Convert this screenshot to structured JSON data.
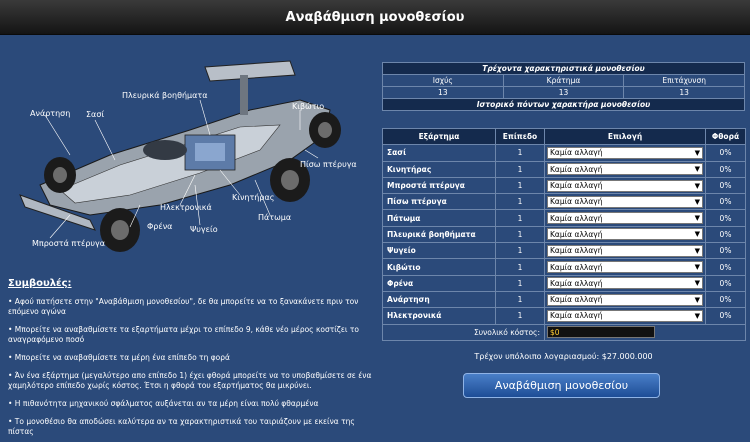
{
  "title": "Αναβάθμιση μονοθεσίου",
  "car_labels": [
    {
      "name": "label-suspension",
      "text": "Ανάρτηση"
    },
    {
      "name": "label-chassis",
      "text": "Σασί"
    },
    {
      "name": "label-sidepods",
      "text": "Πλευρικά βοηθήματα"
    },
    {
      "name": "label-gearbox",
      "text": "Κιβώτιο"
    },
    {
      "name": "label-rear-wing",
      "text": "Πίσω πτέρυγα"
    },
    {
      "name": "label-engine",
      "text": "Κινητήρας"
    },
    {
      "name": "label-electronics",
      "text": "Ηλεκτρονικά"
    },
    {
      "name": "label-floor",
      "text": "Πάτωμα"
    },
    {
      "name": "label-brakes",
      "text": "Φρένα"
    },
    {
      "name": "label-cooling",
      "text": "Ψυγείο"
    },
    {
      "name": "label-front-wing",
      "text": "Μπροστά πτέρυγα"
    }
  ],
  "tips": {
    "title": "Συμβουλές:",
    "items": [
      "• Αφού πατήσετε στην \"Αναβάθμιση μονοθεσίου\", δε θα μπορείτε να το ξανακάνετε πριν τον επόμενο αγώνα",
      "• Μπορείτε να αναβαθμίσετε τα εξαρτήματα μέχρι το επίπεδο 9, κάθε νέο μέρος κοστίζει το αναγραφόμενο ποσό",
      "• Μπορείτε να αναβαθμίσετε τα μέρη ένα επίπεδο τη φορά",
      "• Άν ένα εξάρτημα (μεγαλύτερο απο επίπεδο 1) έχει φθορά μπορείτε να το υποβαθμίσετε σε ένα χαμηλότερο επίπεδο χωρίς κόστος. Έτσι η φθορά του εξαρτήματος θα μικρύνει.",
      "• Η πιθανότητα μηχανικού σφάλματος αυξάνεται αν τα μέρη είναι πολύ φθαρμένα",
      "• Το μονοθέσιο θα αποδώσει καλύτερα αν τα χαρακτηριστικά του ταιριάζουν με εκείνα της πίστας"
    ]
  },
  "current_stats": {
    "header": "Τρέχοντα χαρακτηριστικά μονοθεσίου",
    "columns": [
      "Ισχύς",
      "Κράτημα",
      "Επιτάχυνση"
    ],
    "values": [
      "13",
      "13",
      "13"
    ],
    "history_header": "Ιστορικό πόντων χαρακτήρα μονοθεσίου"
  },
  "parts": {
    "columns": [
      "Εξάρτημα",
      "Επίπεδο",
      "Επιλογή",
      "Φθορά"
    ],
    "rows": [
      {
        "name": "Σασί",
        "level": "1",
        "option": "Καμία αλλαγή",
        "wear": "0%"
      },
      {
        "name": "Κινητήρας",
        "level": "1",
        "option": "Καμία αλλαγή",
        "wear": "0%"
      },
      {
        "name": "Μπροστά πτέρυγα",
        "level": "1",
        "option": "Καμία αλλαγή",
        "wear": "0%"
      },
      {
        "name": "Πίσω πτέρυγα",
        "level": "1",
        "option": "Καμία αλλαγή",
        "wear": "0%"
      },
      {
        "name": "Πάτωμα",
        "level": "1",
        "option": "Καμία αλλαγή",
        "wear": "0%"
      },
      {
        "name": "Πλευρικά βοηθήματα",
        "level": "1",
        "option": "Καμία αλλαγή",
        "wear": "0%"
      },
      {
        "name": "Ψυγείο",
        "level": "1",
        "option": "Καμία αλλαγή",
        "wear": "0%"
      },
      {
        "name": "Κιβώτιο",
        "level": "1",
        "option": "Καμία αλλαγή",
        "wear": "0%"
      },
      {
        "name": "Φρένα",
        "level": "1",
        "option": "Καμία αλλαγή",
        "wear": "0%"
      },
      {
        "name": "Ανάρτηση",
        "level": "1",
        "option": "Καμία αλλαγή",
        "wear": "0%"
      },
      {
        "name": "Ηλεκτρονικά",
        "level": "1",
        "option": "Καμία αλλαγή",
        "wear": "0%"
      }
    ],
    "total_label": "Συνολικό κόστος:",
    "total_value": "$0"
  },
  "balance_text": "Τρέχον υπόλοιπο λογαριασμού: $27.000.000",
  "upgrade_button": "Αναβάθμιση μονοθεσίου",
  "colors": {
    "background": "#2b4a7a",
    "header_cell": "#142a4d",
    "button": "#2f66b4"
  }
}
